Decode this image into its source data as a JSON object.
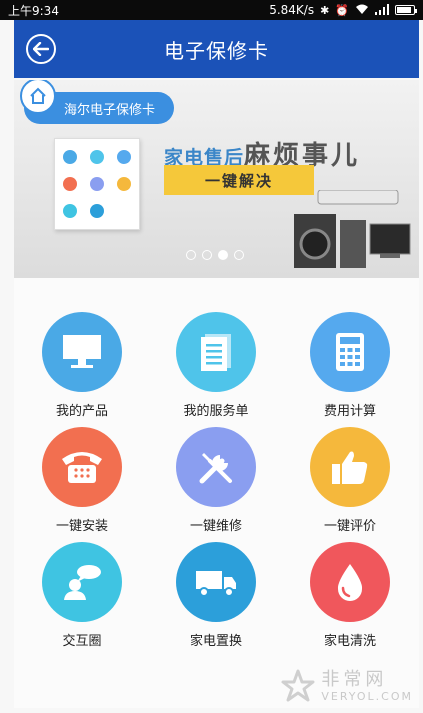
{
  "status_bar": {
    "time": "上午9:34",
    "network_speed": "5.84K/s",
    "battery_level": 0.85
  },
  "header": {
    "title": "电子保修卡"
  },
  "banner": {
    "card_label": "海尔电子保修卡",
    "slogan_prefix": "家电售后",
    "slogan_emphasis": "麻烦事儿",
    "slogan_sub": "一键解决",
    "carousel": {
      "count": 4,
      "active_index": 2
    }
  },
  "grid": {
    "items": [
      {
        "label": "我的产品",
        "icon": "monitor-icon",
        "color": "#4aa9e6"
      },
      {
        "label": "我的服务单",
        "icon": "document-icon",
        "color": "#4fc4ea"
      },
      {
        "label": "费用计算",
        "icon": "calculator-icon",
        "color": "#55a9ee"
      },
      {
        "label": "一键安装",
        "icon": "phone-icon",
        "color": "#f26f50"
      },
      {
        "label": "一键维修",
        "icon": "tools-icon",
        "color": "#8a9ef0"
      },
      {
        "label": "一键评价",
        "icon": "thumbs-up-icon",
        "color": "#f5b83c"
      },
      {
        "label": "交互圈",
        "icon": "chat-person-icon",
        "color": "#3fc4e2"
      },
      {
        "label": "家电置换",
        "icon": "truck-icon",
        "color": "#2c9fda"
      },
      {
        "label": "家电清洗",
        "icon": "water-drop-icon",
        "color": "#f0575c"
      }
    ]
  },
  "watermark": {
    "cn": "非常网",
    "en": "VERYOL.COM"
  }
}
